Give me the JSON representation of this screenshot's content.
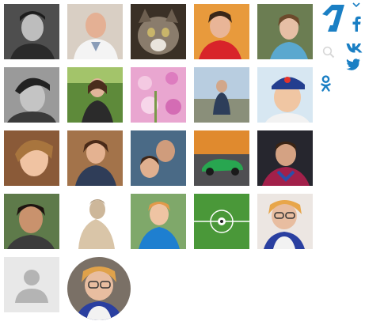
{
  "brand": {
    "logo_icon": "channel-one-logo-icon",
    "accent_color": "#1a7fc4"
  },
  "social": [
    {
      "name": "facebook",
      "icon": "facebook-icon"
    },
    {
      "name": "vk",
      "icon": "vk-icon"
    },
    {
      "name": "twitter",
      "icon": "twitter-icon"
    },
    {
      "name": "odnoklassniki",
      "icon": "odnoklassniki-icon"
    }
  ],
  "toolbar": {
    "search_icon": "search-icon",
    "expand_icon": "chevron-down-icon"
  },
  "avatars": [
    {
      "description": "man-black-white-portrait"
    },
    {
      "description": "doctor-in-white-coat"
    },
    {
      "description": "cat"
    },
    {
      "description": "woman-red-dress"
    },
    {
      "description": "woman-smiling"
    },
    {
      "description": "man-black-white"
    },
    {
      "description": "woman-outdoor"
    },
    {
      "description": "pink-flowers"
    },
    {
      "description": "man-sitting-outdoors"
    },
    {
      "description": "man-with-cap"
    },
    {
      "description": "woman-blonde-smiling"
    },
    {
      "description": "woman-curly-hair"
    },
    {
      "description": "couple-selfie"
    },
    {
      "description": "green-sports-car"
    },
    {
      "description": "football-player"
    },
    {
      "description": "man-smiling"
    },
    {
      "description": "statue-bust"
    },
    {
      "description": "woman-blue-dress"
    },
    {
      "description": "football-field"
    },
    {
      "description": "elderly-woman-glasses"
    },
    {
      "description": "default-user-placeholder"
    },
    {
      "description": "elderly-woman-glasses-round"
    }
  ]
}
